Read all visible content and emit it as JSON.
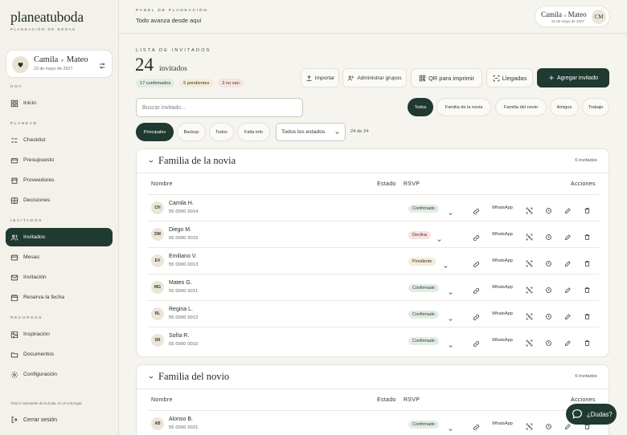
{
  "brand": {
    "logo": "planeatuboda",
    "tagline": "Planeación de bodas"
  },
  "couple": {
    "name1": "Camila",
    "sep": "∨",
    "name2": "Mateo",
    "date": "22 de mayo de 2027",
    "monogram": "CM"
  },
  "nav": {
    "sections": {
      "hoy": "Hoy",
      "planear": "Planear",
      "invitados": "Invitados",
      "recursos": "Recursos"
    },
    "items": [
      {
        "label": "Inicio",
        "icon": "grid-icon"
      },
      {
        "label": "Checklist",
        "icon": "checklist-icon"
      },
      {
        "label": "Presupuesto",
        "icon": "budget-icon"
      },
      {
        "label": "Proveedores",
        "icon": "vendors-icon"
      },
      {
        "label": "Decisiones",
        "icon": "decisions-icon"
      },
      {
        "label": "Invitados",
        "icon": "guests-icon",
        "active": true
      },
      {
        "label": "Mesas",
        "icon": "tables-icon"
      },
      {
        "label": "Invitación",
        "icon": "invitation-icon"
      },
      {
        "label": "Reserva la fecha",
        "icon": "save-date-icon"
      },
      {
        "label": "Inspiración",
        "icon": "inspiration-icon"
      },
      {
        "label": "Documentos",
        "icon": "documents-icon"
      },
      {
        "label": "Configuración",
        "icon": "settings-icon"
      }
    ],
    "footnote": "Todo lo importante de su boda, en un solo lugar.",
    "logout": "Cerrar sesión"
  },
  "header": {
    "eyebrow": "Panel de planeación",
    "subtitle": "Todo avanza desde aquí"
  },
  "guests": {
    "eyebrow": "Lista de invitados",
    "count": "24",
    "count_label": "invitados",
    "pills": {
      "confirmed": "17 confirmados",
      "pending": "5 pendientes",
      "declined": "2 no van"
    },
    "actions": {
      "import": "Importar",
      "groups": "Administrar grupos",
      "qr": "QR para imprimir",
      "arrivals": "Llegadas",
      "add": "Agregar invitado"
    },
    "search_placeholder": "Buscar invitado...",
    "group_filters": [
      "Todos",
      "Familia de la novia",
      "Familia del novio",
      "Amigos",
      "Trabajo"
    ],
    "tier_filters": [
      "Principales",
      "Backup",
      "Todos",
      "Falta info"
    ],
    "status_select": "Todos los estados",
    "showing": "24 de 24"
  },
  "table_headers": {
    "name": "Nombre",
    "status": "Estado",
    "rsvp": "RSVP",
    "actions": "Acciones"
  },
  "groups": [
    {
      "title": "Familia de la novia",
      "count": "6 invitados",
      "rows": [
        {
          "initials": "CH",
          "name": "Camila H.",
          "phone": "55 0000 0014",
          "status": "Confirmado",
          "status_key": "confirmado",
          "contact": "WhatsApp"
        },
        {
          "initials": "DM",
          "name": "Diego M.",
          "phone": "55 0000 0015",
          "status": "Declina",
          "status_key": "declina",
          "contact": "WhatsApp"
        },
        {
          "initials": "EV",
          "name": "Emiliano V.",
          "phone": "55 0000 0013",
          "status": "Pendiente",
          "status_key": "pendiente",
          "contact": "WhatsApp"
        },
        {
          "initials": "MG",
          "name": "Mateo G.",
          "phone": "55 0000 0011",
          "status": "Confirmado",
          "status_key": "confirmado",
          "contact": "WhatsApp"
        },
        {
          "initials": "RL",
          "name": "Regina L.",
          "phone": "55 0000 0012",
          "status": "Confirmado",
          "status_key": "confirmado",
          "contact": "WhatsApp"
        },
        {
          "initials": "SR",
          "name": "Sofía R.",
          "phone": "55 0000 0010",
          "status": "Confirmado",
          "status_key": "confirmado",
          "contact": "WhatsApp"
        }
      ]
    },
    {
      "title": "Familia del novio",
      "count": "6 invitados",
      "rows": [
        {
          "initials": "AB",
          "name": "Alonso B.",
          "phone": "55 0000 0021",
          "status": "Confirmado",
          "status_key": "confirmado",
          "contact": "WhatsApp"
        }
      ]
    }
  ],
  "help": "¿Dudas?",
  "colors": {
    "accent": "#1f3a30",
    "background": "#f6f4ee",
    "confirmed_bg": "#e2ece3",
    "declined_bg": "#f5e3df",
    "pending_bg": "#f3ecd8"
  }
}
